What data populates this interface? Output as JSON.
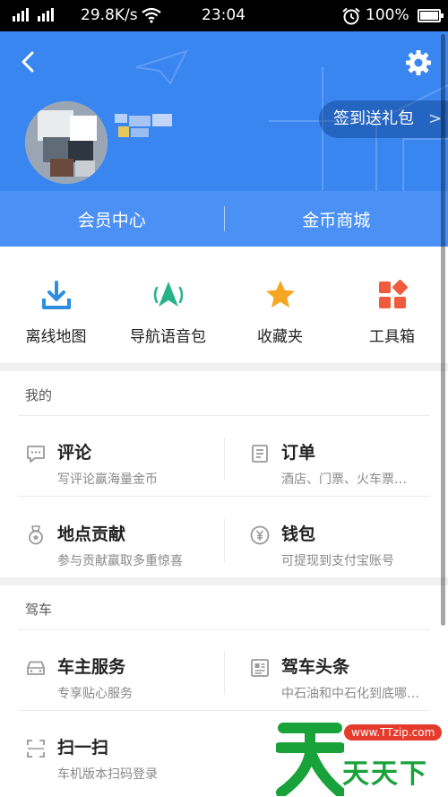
{
  "status_bar": {
    "network_speed": "29.8K/s",
    "time": "23:04",
    "battery": "100%",
    "battery_level": 1.0
  },
  "header": {
    "signin_label": "签到送礼包",
    "signin_chevron": ">",
    "tabs": [
      {
        "label": "会员中心"
      },
      {
        "label": "金币商城"
      }
    ]
  },
  "quick_actions": [
    {
      "label": "离线地图",
      "icon": "download-icon",
      "color": "#2d8de0"
    },
    {
      "label": "导航语音包",
      "icon": "navigation-icon",
      "color": "#26b38a"
    },
    {
      "label": "收藏夹",
      "icon": "star-icon",
      "color": "#f5a623"
    },
    {
      "label": "工具箱",
      "icon": "toolbox-icon",
      "color": "#ef5b3c"
    }
  ],
  "sections": {
    "mine": {
      "title": "我的",
      "items": [
        {
          "title": "评论",
          "subtitle": "写评论赢海量金币",
          "icon": "comment-icon"
        },
        {
          "title": "订单",
          "subtitle": "酒店、门票、火车票…",
          "icon": "order-icon"
        },
        {
          "title": "地点贡献",
          "subtitle": "参与贡献赢取多重惊喜",
          "icon": "medal-icon"
        },
        {
          "title": "钱包",
          "subtitle": "可提现到支付宝账号",
          "icon": "wallet-icon"
        }
      ]
    },
    "driving": {
      "title": "驾车",
      "items": [
        {
          "title": "车主服务",
          "subtitle": "专享贴心服务",
          "icon": "car-icon"
        },
        {
          "title": "驾车头条",
          "subtitle": "中石油和中石化到底哪…",
          "icon": "news-icon"
        },
        {
          "title": "扫一扫",
          "subtitle": "车机版本扫码登录",
          "icon": "scan-icon"
        }
      ]
    }
  },
  "watermark": {
    "site": "www.TTzip.com",
    "text": "天天下载"
  },
  "colors": {
    "header_blue": "#3a86f0",
    "tabs_blue": "#4a90f5"
  }
}
